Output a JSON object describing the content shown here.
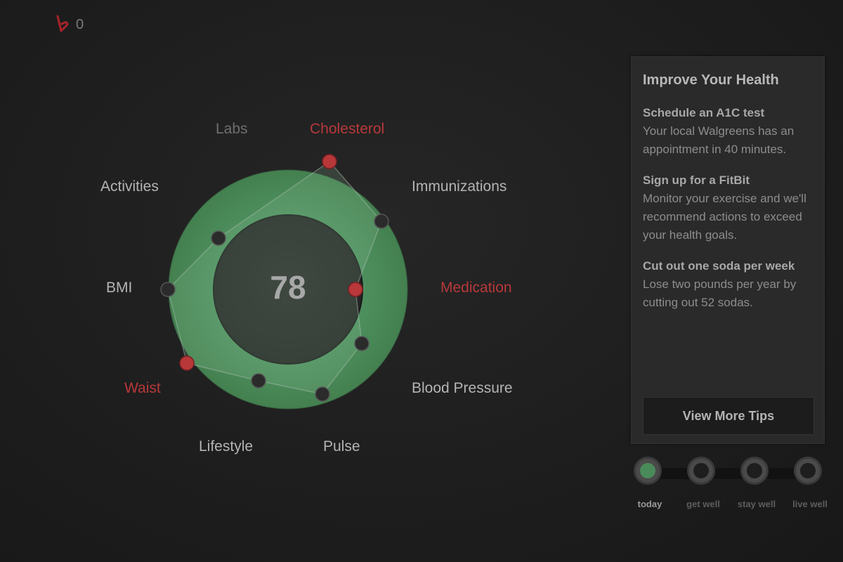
{
  "header": {
    "logo_icon": "walgreens-w-icon",
    "notification_count": "0"
  },
  "score": {
    "value": "78"
  },
  "metrics": [
    {
      "label": "Labs",
      "state": "dim",
      "status": "none"
    },
    {
      "label": "Cholesterol",
      "state": "alert",
      "status": "alert"
    },
    {
      "label": "Immunizations",
      "state": "normal",
      "status": "ok"
    },
    {
      "label": "Medication",
      "state": "alert",
      "status": "alert"
    },
    {
      "label": "Blood Pressure",
      "state": "normal",
      "status": "ok"
    },
    {
      "label": "Pulse",
      "state": "normal",
      "status": "ok"
    },
    {
      "label": "Lifestyle",
      "state": "normal",
      "status": "ok"
    },
    {
      "label": "Waist",
      "state": "alert",
      "status": "alert"
    },
    {
      "label": "BMI",
      "state": "normal",
      "status": "ok"
    },
    {
      "label": "Activities",
      "state": "normal",
      "status": "ok"
    }
  ],
  "tips": {
    "title": "Improve Your Health",
    "items": [
      {
        "title": "Schedule an A1C test",
        "body": "Your local Walgreens has an appointment in 40 minutes."
      },
      {
        "title": "Sign up for a FitBit",
        "body": "Monitor your exercise and we'll recommend actions to exceed your health goals."
      },
      {
        "title": "Cut out one soda per week",
        "body": "Lose two pounds per year by cutting out 52 sodas."
      }
    ],
    "more_button": "View More Tips"
  },
  "timeline": {
    "steps": [
      {
        "label": "today",
        "active": true
      },
      {
        "label": "get well",
        "active": false
      },
      {
        "label": "stay well",
        "active": false
      },
      {
        "label": "live well",
        "active": false
      }
    ]
  },
  "colors": {
    "ring_green": "#4d8c5d",
    "alert_red": "#b8383a",
    "dot_dark": "#2b2b2b",
    "active_step": "#4b8a5a"
  }
}
